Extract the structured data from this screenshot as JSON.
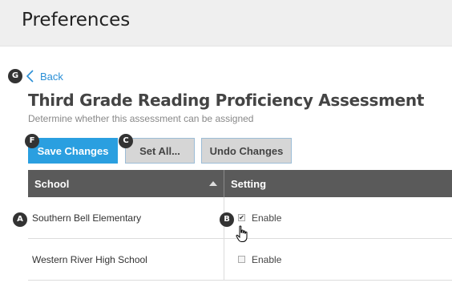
{
  "header": {
    "title": "Preferences"
  },
  "back": {
    "label": "Back"
  },
  "assessment": {
    "title": "Third Grade Reading Proficiency Assessment",
    "subtitle": "Determine whether this assessment can be assigned"
  },
  "toolbar": {
    "save_label": "Save Changes",
    "set_all_label": "Set All...",
    "undo_label": "Undo Changes"
  },
  "table": {
    "headers": {
      "school": "School",
      "setting": "Setting"
    },
    "rows": [
      {
        "school": "Southern Bell Elementary",
        "setting_label": "Enable",
        "checked": true
      },
      {
        "school": "Western River High School",
        "setting_label": "Enable",
        "checked": false
      }
    ]
  },
  "callouts": {
    "a": "A",
    "b": "B",
    "c": "C",
    "f": "F",
    "g": "G"
  },
  "colors": {
    "accent": "#2a9fe0",
    "header_bg": "#5a5a5a",
    "link": "#2a8fd6"
  }
}
